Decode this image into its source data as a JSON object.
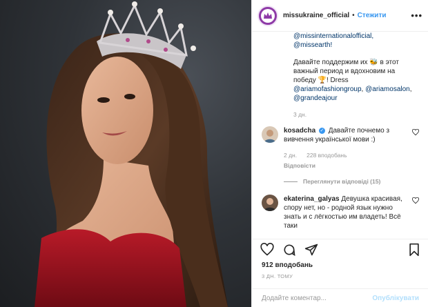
{
  "header": {
    "username": "missukraine_official",
    "separator": "•",
    "follow_label": "Стежити",
    "more_icon": "more-icon"
  },
  "caption": {
    "line1": "@missinternationalofficial,",
    "line2": "@missearth!",
    "para2_a": "Давайте поддержим их 🐝 в этот важный период и вдохновим на победу 🏆! Dress ",
    "tag1": "@ariamofashiongroup",
    "sep1": ", ",
    "tag2": "@ariamosalon",
    "sep2": ", ",
    "tag3": "@grandeajour",
    "time": "3 дн."
  },
  "comments": [
    {
      "username": "kosadcha",
      "text": "Давайте почнемо з вивчення української мови :)",
      "time": "2 дн.",
      "likes": "228 вподобань",
      "reply": "Відповісти",
      "view_replies": "Переглянути відповіді (15)"
    },
    {
      "username": "ekaterina_galyas",
      "text": "Девушка красивая, спору нет, но - родной язык нужно знать и с лёгкостью им владеть! Всё таки"
    }
  ],
  "likes": "912 вподобань",
  "date": "3 ДН. ТОМУ",
  "add_comment": {
    "placeholder": "Додайте коментар...",
    "publish_label": "Опублікувати"
  },
  "colors": {
    "accent": "#3897f0",
    "avatar_brand": "#8e3aa7",
    "dress": "#9b1420"
  }
}
